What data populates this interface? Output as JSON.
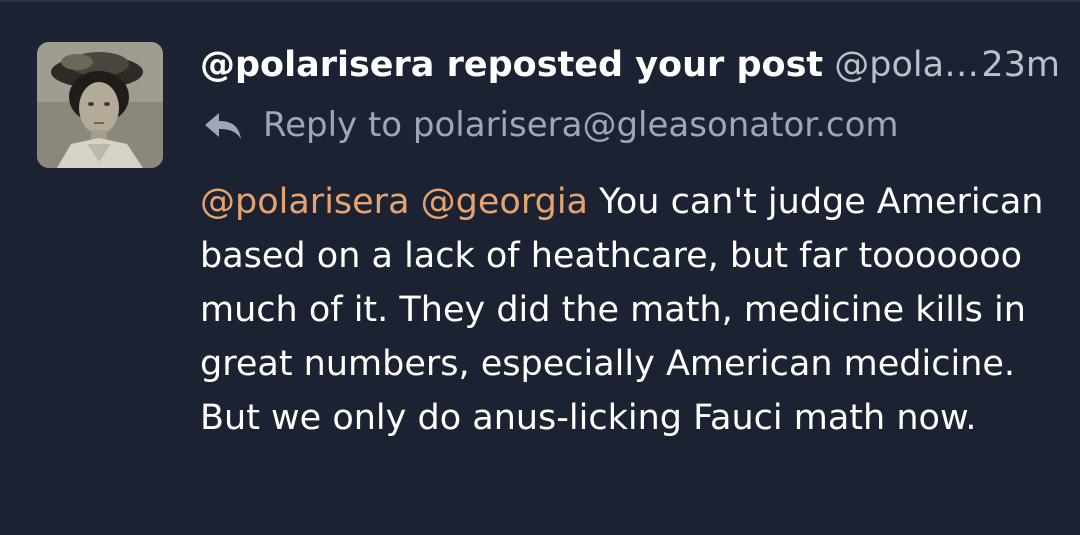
{
  "post": {
    "actor": "@polarisera reposted your post",
    "handle_truncated": "@pola…",
    "time": "23m",
    "reply_to": "Reply to polarisera@gleasonator.com",
    "mention_1": "@polarisera",
    "mention_2": "@georgia",
    "text": " You can't judge American based on a lack of heathcare, but far tooooooo much of it. They did the math, medicine kills in great numbers, especially American medicine. But we only do anus-licking Fauci math now.",
    "colors": {
      "background": "#1b2232",
      "mention": "#e7a36f",
      "text": "#ffffff",
      "muted": "#b9bfcb"
    },
    "icons": {
      "reply": "reply-arrow-icon",
      "avatar": "user-avatar-photo"
    }
  }
}
